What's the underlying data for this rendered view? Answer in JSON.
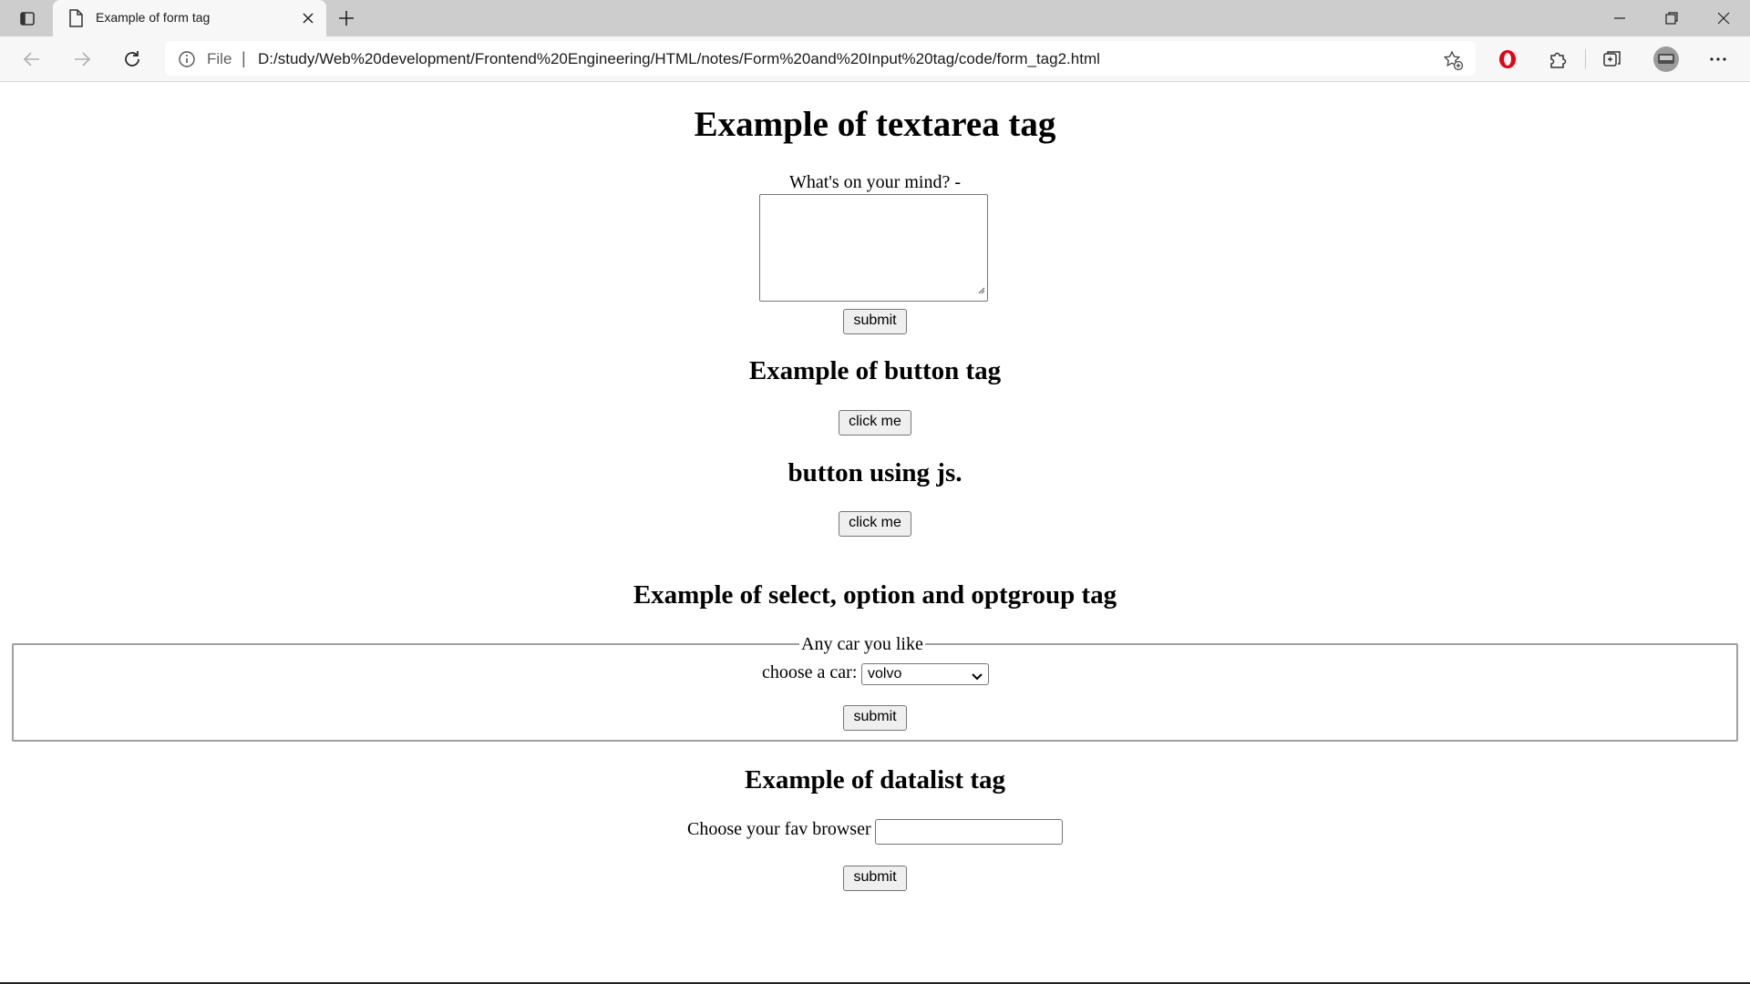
{
  "browser": {
    "tab_title": "Example of form tag",
    "address_scheme": "File",
    "address_separator": "|",
    "url": "D:/study/Web%20development/Frontend%20Engineering/HTML/notes/Form%20and%20Input%20tag/code/form_tag2.html"
  },
  "textarea_section": {
    "heading": "Example of textarea tag",
    "label": "What's on your mind? -",
    "textarea_value": "",
    "submit_label": "submit"
  },
  "button_section": {
    "heading": "Example of button tag",
    "button_label": "click me"
  },
  "js_button_section": {
    "heading": "button using js.",
    "button_label": "click me"
  },
  "select_section": {
    "heading": "Example of select, option and optgroup tag",
    "legend": "Any car you like",
    "label": "choose a car:",
    "selected_option": "volvo",
    "submit_label": "submit"
  },
  "datalist_section": {
    "heading": "Example of datalist tag",
    "label": "Choose your fav browser",
    "input_value": "",
    "submit_label": "submit"
  },
  "icons": {
    "tab_actions": "tab-actions-icon",
    "page": "page-icon",
    "close": "close-icon",
    "new_tab": "plus-icon",
    "back": "back-arrow-icon",
    "forward": "forward-arrow-icon",
    "refresh": "refresh-icon",
    "info": "info-icon",
    "favorite": "star-plus-icon",
    "opera": "opera-icon",
    "extensions": "puzzle-icon",
    "collections": "collections-icon",
    "profile": "avatar",
    "menu": "more-icon"
  }
}
